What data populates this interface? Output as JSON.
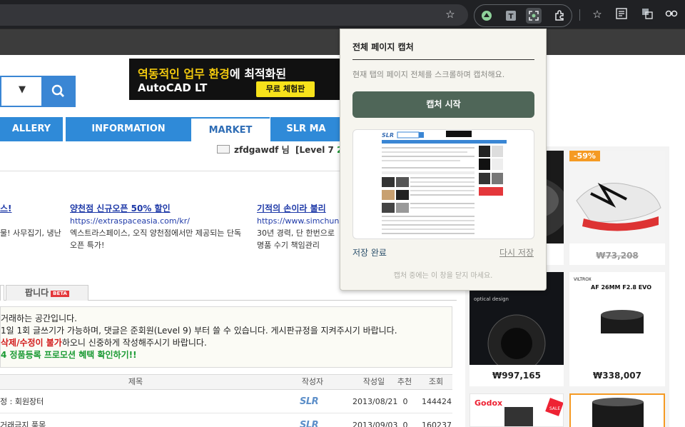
{
  "popup": {
    "title": "전체 페이지 캡처",
    "description": "현재 탭의 페이지 전체를 스크롤하며 캡처해요.",
    "capture_button": "캡처 시작",
    "status": "저장 완료",
    "retry_link": "다시 저장",
    "footer_note": "캡처 중에는 이 창을 닫지 마세요."
  },
  "ad": {
    "line1_highlight": "역동적인 업무 환경",
    "line1_rest": "에 최적화된",
    "line2": "AutoCAD LT",
    "cta": "무료 체험판"
  },
  "nav": {
    "items": [
      "ALLERY",
      "INFORMATION",
      "MARKET",
      "SLR MA"
    ]
  },
  "user": {
    "name": "zfdgawdf",
    "suffix": "님",
    "level_label": "[Level 7",
    "level_value": "2,"
  },
  "promos": [
    {
      "title": "스!",
      "url": "",
      "desc": "물! 사무집기, 냉난"
    },
    {
      "title": "양천점 신규오픈 50% 할인",
      "url": "https://extraspaceasia.com/kr/",
      "desc": "엑스트라스페이스, 오직 양천점에서만 제공되는 단독 오픈 특가!"
    },
    {
      "title": "기적의 손이라 불리",
      "url": "https://www.simchung",
      "desc": "30년 경력, 단 한번으로 명품 수기 책임관리"
    }
  ],
  "tabs": {
    "tip": "팝니다",
    "beta": "BETA"
  },
  "notice": {
    "line1": "거래하는 공간입니다.",
    "line2": "1일 1회 글쓰기가 가능하며, 댓글은 준회원(Level 9) 부터 쓸 수 있습니다. 게시판규정을 지켜주시기 바랍니다.",
    "line3_red": "삭제/수정이 불가",
    "line3_rest": "하오니 신중하게 작성해주시기 바랍니다.",
    "line4": "4 정품등록 프로모션 혜택 확인하기!!"
  },
  "table": {
    "headers": [
      "제목",
      "작성자",
      "작성일",
      "추천",
      "조회"
    ],
    "rows": [
      {
        "title": "정 : 회원장터",
        "author_logo": "SLR",
        "date": "2013/08/21",
        "likes": "0",
        "views": "144424"
      },
      {
        "title": "거래금지 품목",
        "author_logo": "SLR",
        "date": "2013/09/03",
        "likes": "0",
        "views": "160237"
      }
    ]
  },
  "products": [
    {
      "price": "",
      "strike": false,
      "badge": ""
    },
    {
      "price": "₩73,208",
      "strike": true,
      "badge": "-59%"
    },
    {
      "price": "₩997,165",
      "strike": false,
      "badge": ""
    },
    {
      "price": "₩338,007",
      "strike": false,
      "badge": ""
    },
    {
      "price": "",
      "strike": false,
      "badge": ""
    },
    {
      "price": "",
      "strike": false,
      "badge": ""
    }
  ],
  "product_texts": {
    "lens_brand": "VILTROX",
    "lens_model": "AF 26MM F2.8 EVO",
    "optical_caption": "optical design",
    "brand_godox": "Godox",
    "sale_tag": "SALE"
  },
  "colors": {
    "accent_blue": "#2f8ad8",
    "popup_button": "#4f6658",
    "sale_orange": "#f59a23"
  }
}
